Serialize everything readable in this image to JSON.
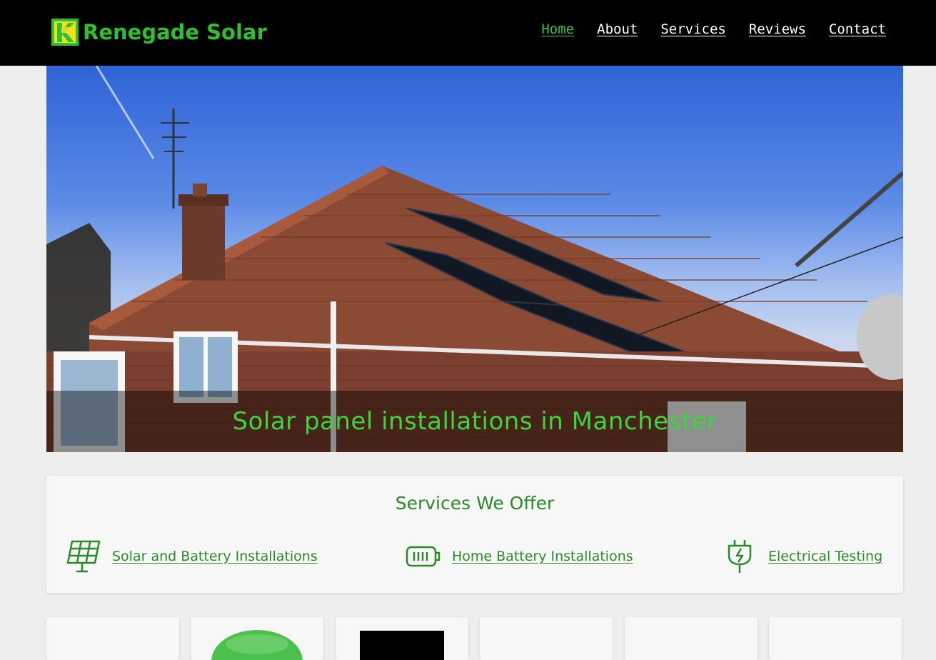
{
  "header": {
    "logo_text": "Renegade Solar",
    "nav": [
      {
        "label": "Home",
        "active": true
      },
      {
        "label": "About",
        "active": false
      },
      {
        "label": "Services",
        "active": false
      },
      {
        "label": "Reviews",
        "active": false
      },
      {
        "label": "Contact",
        "active": false
      }
    ]
  },
  "hero": {
    "caption": "Solar panel installations in Manchester"
  },
  "services": {
    "title": "Services We Offer",
    "items": [
      {
        "label": "Solar and Battery Installations",
        "icon": "solar-panel-icon"
      },
      {
        "label": "Home Battery Installations",
        "icon": "battery-icon"
      },
      {
        "label": "Electrical Testing",
        "icon": "plug-icon"
      }
    ]
  },
  "colors": {
    "brand_green": "#2ec02e",
    "accent_dark_green": "#2a8a2a",
    "header_bg": "#000000",
    "page_bg": "#eeeeee"
  }
}
